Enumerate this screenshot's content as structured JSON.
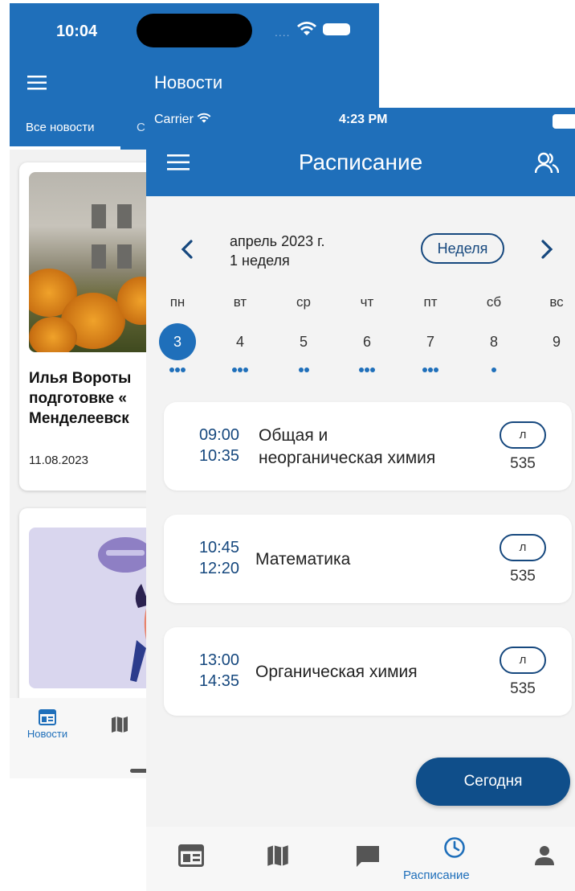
{
  "news_screen": {
    "status_time": "10:04",
    "status_dots": "....",
    "title": "Новости",
    "tab_all": "Все новости",
    "tab_second_partial": "С",
    "card1": {
      "headline_lines": [
        "Илья Вороты",
        "подготовке «",
        "Менделеевск"
      ],
      "date": "11.08.2023"
    },
    "bottom_tab_news": "Новости"
  },
  "schedule": {
    "status": {
      "carrier": "Carrier",
      "time": "4:23 PM"
    },
    "title": "Расписание",
    "calendar": {
      "month": "апрель 2023 г.",
      "week": "1 неделя",
      "view_button": "Неделя",
      "days": [
        {
          "name": "пн",
          "num": "3",
          "dots": 3,
          "selected": true
        },
        {
          "name": "вт",
          "num": "4",
          "dots": 3,
          "selected": false
        },
        {
          "name": "ср",
          "num": "5",
          "dots": 2,
          "selected": false
        },
        {
          "name": "чт",
          "num": "6",
          "dots": 3,
          "selected": false
        },
        {
          "name": "пт",
          "num": "7",
          "dots": 3,
          "selected": false
        },
        {
          "name": "сб",
          "num": "8",
          "dots": 1,
          "selected": false
        },
        {
          "name": "вс",
          "num": "9",
          "dots": 0,
          "selected": false
        }
      ]
    },
    "lessons": [
      {
        "start": "09:00",
        "end": "10:35",
        "name_lines": [
          "Общая и",
          "неорганическая химия"
        ],
        "type": "л",
        "room": "535"
      },
      {
        "start": "10:45",
        "end": "12:20",
        "name_lines": [
          "Математика"
        ],
        "type": "л",
        "room": "535"
      },
      {
        "start": "13:00",
        "end": "14:35",
        "name_lines": [
          "Органическая химия"
        ],
        "type": "л",
        "room": "535"
      }
    ],
    "today_button": "Сегодня",
    "tabbar_active_label": "Расписание",
    "colors": {
      "primary": "#1f6fba",
      "dark": "#16487e",
      "today": "#0f4e8a"
    }
  }
}
